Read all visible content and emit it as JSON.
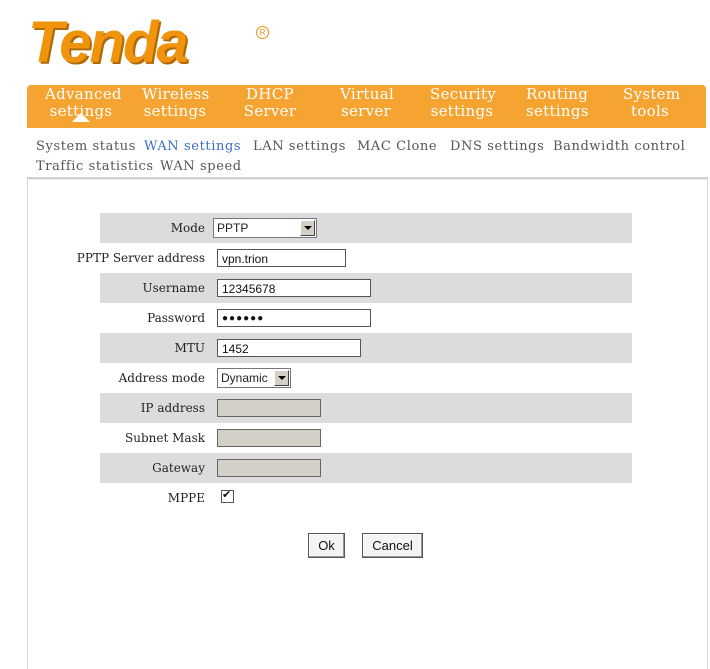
{
  "brand": {
    "logo_text": "Tenda",
    "reg_mark": "R",
    "accent": "#f6a431"
  },
  "nav": {
    "items": [
      {
        "line1": "Advanced",
        "line2": "settings"
      },
      {
        "line1": "Wireless",
        "line2": "settings"
      },
      {
        "line1": "DHCP",
        "line2": "Server"
      },
      {
        "line1": "Virtual",
        "line2": "server"
      },
      {
        "line1": "Security",
        "line2": "settings"
      },
      {
        "line1": "Routing",
        "line2": "settings"
      },
      {
        "line1": "System",
        "line2": "tools"
      }
    ]
  },
  "subnav": {
    "items": [
      "System status",
      "WAN settings",
      "LAN settings",
      "MAC Clone",
      "DNS settings",
      "Bandwidth control",
      "Traffic statistics",
      "WAN speed"
    ]
  },
  "form": {
    "mode": {
      "label": "Mode",
      "value": "PPTP"
    },
    "server": {
      "label": "PPTP Server address",
      "value": "vpn.trion"
    },
    "username": {
      "label": "Username",
      "value": "12345678"
    },
    "password": {
      "label": "Password",
      "value": "●●●●●●"
    },
    "mtu": {
      "label": "MTU",
      "value": "1452"
    },
    "address_mode": {
      "label": "Address mode",
      "value": "Dynamic"
    },
    "ip": {
      "label": "IP address",
      "value": ""
    },
    "mask": {
      "label": "Subnet Mask",
      "value": ""
    },
    "gateway": {
      "label": "Gateway",
      "value": ""
    },
    "mppe": {
      "label": "MPPE",
      "checked": true
    }
  },
  "buttons": {
    "ok": "Ok",
    "cancel": "Cancel"
  }
}
